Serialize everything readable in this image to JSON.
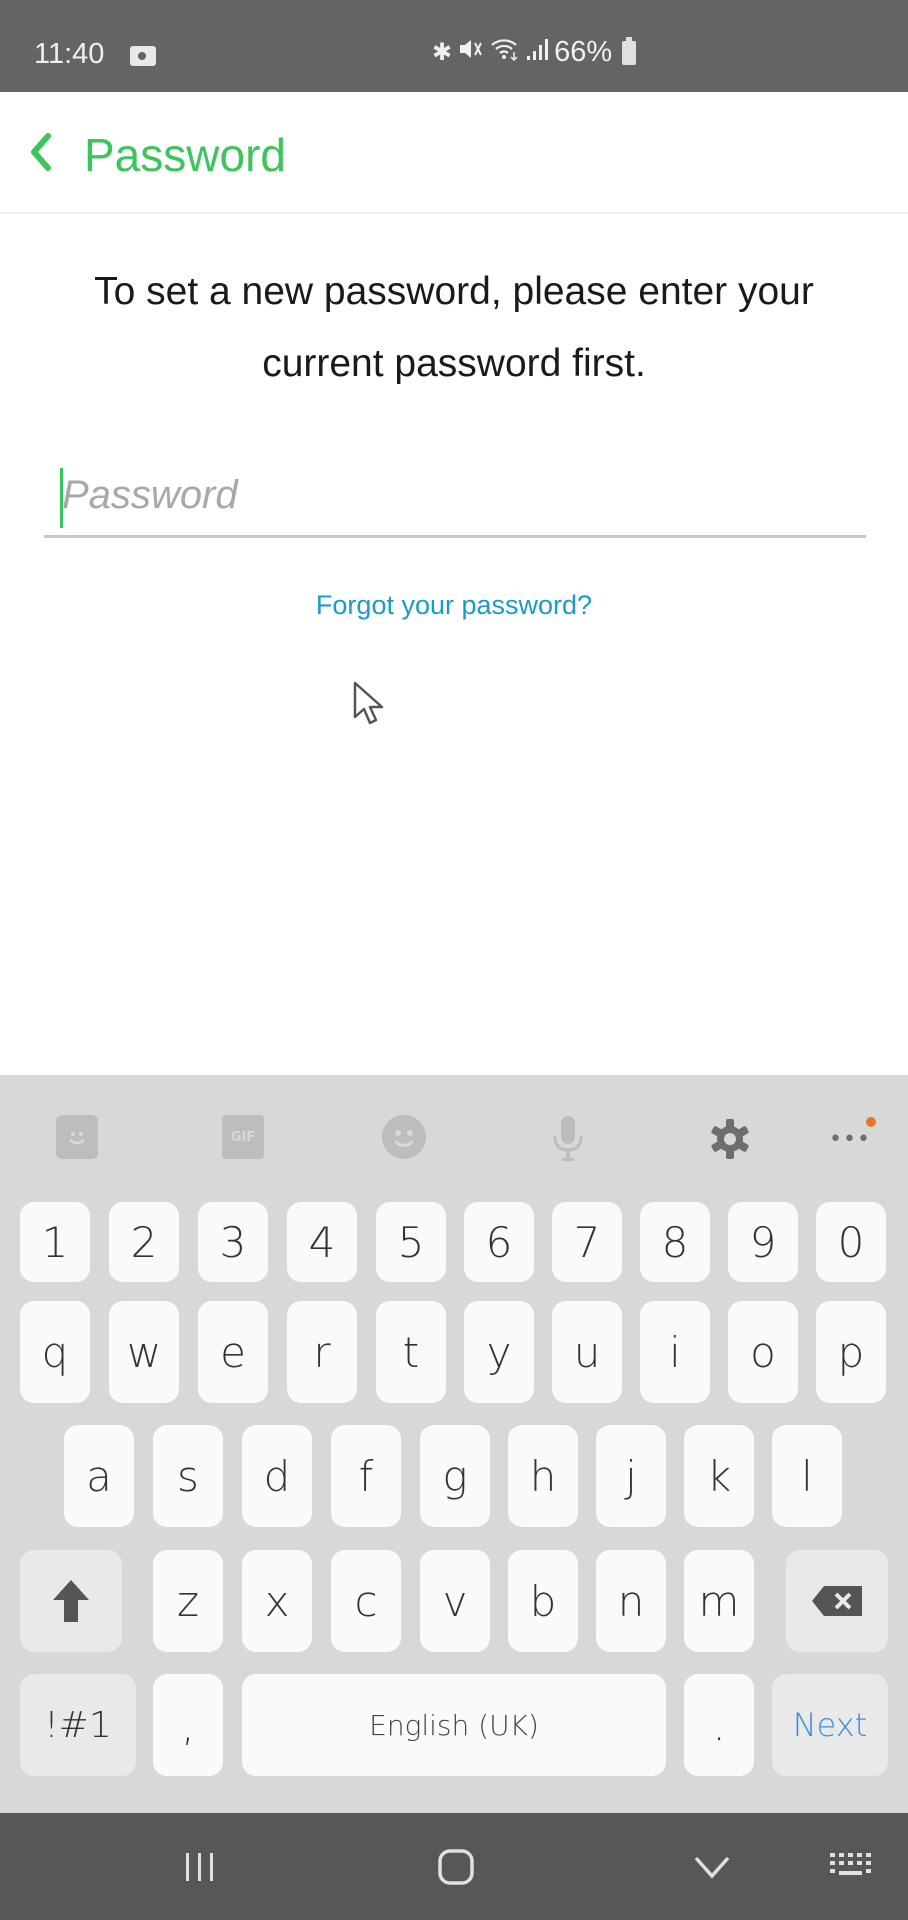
{
  "status_bar": {
    "time": "11:40",
    "battery_percent": "66%",
    "icons": [
      "video-record-icon",
      "bluetooth-icon",
      "mute-icon",
      "wifi-icon",
      "signal-icon",
      "battery-icon"
    ]
  },
  "header": {
    "back_icon": "chevron-left-icon",
    "title": "Password",
    "accent_color": "#3cc55a"
  },
  "main": {
    "instruction": "To set a new password, please enter your current password first.",
    "password_field": {
      "placeholder": "Password",
      "value": ""
    },
    "forgot_link": "Forgot your password?",
    "link_color": "#1a9bc8"
  },
  "keyboard": {
    "toolbar": [
      "sticker-icon",
      "gif-icon",
      "emoji-icon",
      "mic-icon",
      "gear-icon",
      "more-icon"
    ],
    "gif_label": "GIF",
    "more_label": "•••",
    "rows": [
      [
        "1",
        "2",
        "3",
        "4",
        "5",
        "6",
        "7",
        "8",
        "9",
        "0"
      ],
      [
        "q",
        "w",
        "e",
        "r",
        "t",
        "y",
        "u",
        "i",
        "o",
        "p"
      ],
      [
        "a",
        "s",
        "d",
        "f",
        "g",
        "h",
        "j",
        "k",
        "l"
      ],
      [
        "z",
        "x",
        "c",
        "v",
        "b",
        "n",
        "m"
      ]
    ],
    "symbols_label": "!#1",
    "comma_label": ",",
    "space_label": "English (UK)",
    "period_label": ".",
    "action_label": "Next",
    "action_color": "#3d8fde"
  },
  "nav_bar": {
    "buttons": [
      "recent-apps-icon",
      "home-icon",
      "back-down-icon",
      "keyboard-switch-icon"
    ]
  }
}
